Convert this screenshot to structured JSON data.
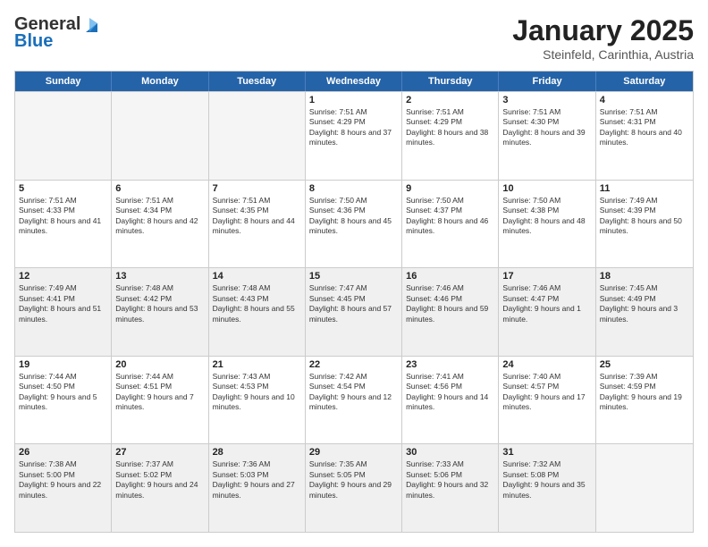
{
  "header": {
    "logo_general": "General",
    "logo_blue": "Blue",
    "title": "January 2025",
    "subtitle": "Steinfeld, Carinthia, Austria"
  },
  "days_of_week": [
    "Sunday",
    "Monday",
    "Tuesday",
    "Wednesday",
    "Thursday",
    "Friday",
    "Saturday"
  ],
  "rows": [
    [
      {
        "day": "",
        "text": "",
        "empty": true
      },
      {
        "day": "",
        "text": "",
        "empty": true
      },
      {
        "day": "",
        "text": "",
        "empty": true
      },
      {
        "day": "1",
        "text": "Sunrise: 7:51 AM\nSunset: 4:29 PM\nDaylight: 8 hours and 37 minutes."
      },
      {
        "day": "2",
        "text": "Sunrise: 7:51 AM\nSunset: 4:29 PM\nDaylight: 8 hours and 38 minutes."
      },
      {
        "day": "3",
        "text": "Sunrise: 7:51 AM\nSunset: 4:30 PM\nDaylight: 8 hours and 39 minutes."
      },
      {
        "day": "4",
        "text": "Sunrise: 7:51 AM\nSunset: 4:31 PM\nDaylight: 8 hours and 40 minutes."
      }
    ],
    [
      {
        "day": "5",
        "text": "Sunrise: 7:51 AM\nSunset: 4:33 PM\nDaylight: 8 hours and 41 minutes."
      },
      {
        "day": "6",
        "text": "Sunrise: 7:51 AM\nSunset: 4:34 PM\nDaylight: 8 hours and 42 minutes."
      },
      {
        "day": "7",
        "text": "Sunrise: 7:51 AM\nSunset: 4:35 PM\nDaylight: 8 hours and 44 minutes."
      },
      {
        "day": "8",
        "text": "Sunrise: 7:50 AM\nSunset: 4:36 PM\nDaylight: 8 hours and 45 minutes."
      },
      {
        "day": "9",
        "text": "Sunrise: 7:50 AM\nSunset: 4:37 PM\nDaylight: 8 hours and 46 minutes."
      },
      {
        "day": "10",
        "text": "Sunrise: 7:50 AM\nSunset: 4:38 PM\nDaylight: 8 hours and 48 minutes."
      },
      {
        "day": "11",
        "text": "Sunrise: 7:49 AM\nSunset: 4:39 PM\nDaylight: 8 hours and 50 minutes."
      }
    ],
    [
      {
        "day": "12",
        "text": "Sunrise: 7:49 AM\nSunset: 4:41 PM\nDaylight: 8 hours and 51 minutes.",
        "shaded": true
      },
      {
        "day": "13",
        "text": "Sunrise: 7:48 AM\nSunset: 4:42 PM\nDaylight: 8 hours and 53 minutes.",
        "shaded": true
      },
      {
        "day": "14",
        "text": "Sunrise: 7:48 AM\nSunset: 4:43 PM\nDaylight: 8 hours and 55 minutes.",
        "shaded": true
      },
      {
        "day": "15",
        "text": "Sunrise: 7:47 AM\nSunset: 4:45 PM\nDaylight: 8 hours and 57 minutes.",
        "shaded": true
      },
      {
        "day": "16",
        "text": "Sunrise: 7:46 AM\nSunset: 4:46 PM\nDaylight: 8 hours and 59 minutes.",
        "shaded": true
      },
      {
        "day": "17",
        "text": "Sunrise: 7:46 AM\nSunset: 4:47 PM\nDaylight: 9 hours and 1 minute.",
        "shaded": true
      },
      {
        "day": "18",
        "text": "Sunrise: 7:45 AM\nSunset: 4:49 PM\nDaylight: 9 hours and 3 minutes.",
        "shaded": true
      }
    ],
    [
      {
        "day": "19",
        "text": "Sunrise: 7:44 AM\nSunset: 4:50 PM\nDaylight: 9 hours and 5 minutes."
      },
      {
        "day": "20",
        "text": "Sunrise: 7:44 AM\nSunset: 4:51 PM\nDaylight: 9 hours and 7 minutes."
      },
      {
        "day": "21",
        "text": "Sunrise: 7:43 AM\nSunset: 4:53 PM\nDaylight: 9 hours and 10 minutes."
      },
      {
        "day": "22",
        "text": "Sunrise: 7:42 AM\nSunset: 4:54 PM\nDaylight: 9 hours and 12 minutes."
      },
      {
        "day": "23",
        "text": "Sunrise: 7:41 AM\nSunset: 4:56 PM\nDaylight: 9 hours and 14 minutes."
      },
      {
        "day": "24",
        "text": "Sunrise: 7:40 AM\nSunset: 4:57 PM\nDaylight: 9 hours and 17 minutes."
      },
      {
        "day": "25",
        "text": "Sunrise: 7:39 AM\nSunset: 4:59 PM\nDaylight: 9 hours and 19 minutes."
      }
    ],
    [
      {
        "day": "26",
        "text": "Sunrise: 7:38 AM\nSunset: 5:00 PM\nDaylight: 9 hours and 22 minutes.",
        "shaded": true
      },
      {
        "day": "27",
        "text": "Sunrise: 7:37 AM\nSunset: 5:02 PM\nDaylight: 9 hours and 24 minutes.",
        "shaded": true
      },
      {
        "day": "28",
        "text": "Sunrise: 7:36 AM\nSunset: 5:03 PM\nDaylight: 9 hours and 27 minutes.",
        "shaded": true
      },
      {
        "day": "29",
        "text": "Sunrise: 7:35 AM\nSunset: 5:05 PM\nDaylight: 9 hours and 29 minutes.",
        "shaded": true
      },
      {
        "day": "30",
        "text": "Sunrise: 7:33 AM\nSunset: 5:06 PM\nDaylight: 9 hours and 32 minutes.",
        "shaded": true
      },
      {
        "day": "31",
        "text": "Sunrise: 7:32 AM\nSunset: 5:08 PM\nDaylight: 9 hours and 35 minutes.",
        "shaded": true
      },
      {
        "day": "",
        "text": "",
        "empty": true,
        "shaded": false
      }
    ]
  ]
}
